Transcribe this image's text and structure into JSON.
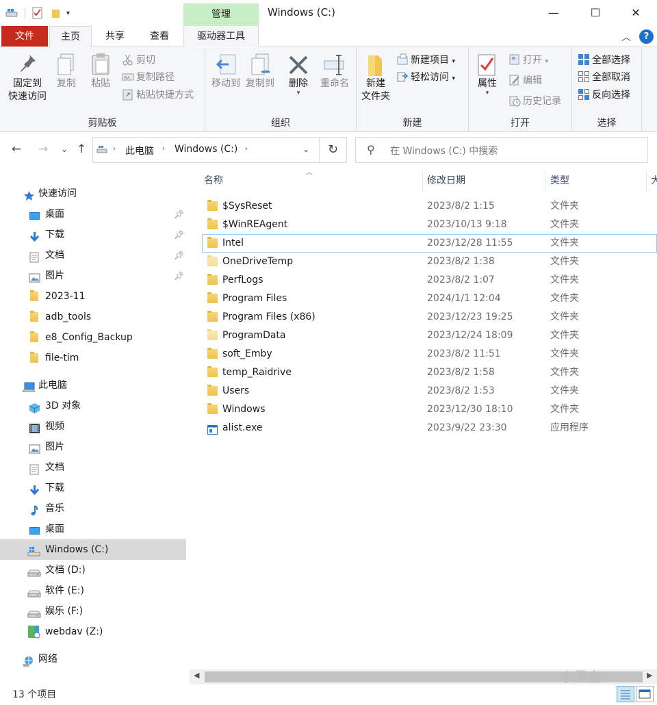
{
  "window": {
    "title": "Windows (C:)",
    "manage_tab": "管理",
    "minimize": "—",
    "maximize": "☐",
    "close": "✕"
  },
  "tabs": {
    "file": "文件",
    "home": "主页",
    "share": "共享",
    "view": "查看",
    "drive_tools": "驱动器工具",
    "help": "?"
  },
  "ribbon": {
    "clipboard": {
      "label": "剪贴板",
      "pin_quick_access": [
        "固定到",
        "快速访问"
      ],
      "copy": "复制",
      "paste": "粘贴",
      "cut": "剪切",
      "copy_path": "复制路径",
      "paste_shortcut": "粘贴快捷方式"
    },
    "organize": {
      "label": "组织",
      "move_to": "移动到",
      "copy_to": "复制到",
      "delete": "删除",
      "rename": "重命名"
    },
    "new": {
      "label": "新建",
      "new_folder": [
        "新建",
        "文件夹"
      ],
      "new_item": "新建项目",
      "easy_access": "轻松访问"
    },
    "open": {
      "label": "打开",
      "properties": "属性",
      "open": "打开",
      "edit": "编辑",
      "history": "历史记录"
    },
    "select": {
      "label": "选择",
      "select_all": "全部选择",
      "select_none": "全部取消",
      "invert": "反向选择"
    }
  },
  "address": {
    "crumbs": [
      "此电脑",
      "Windows (C:)"
    ],
    "search_placeholder": "在 Windows (C:) 中搜索"
  },
  "nav": {
    "quick_access": "快速访问",
    "quick_items": [
      {
        "label": "桌面",
        "icon": "desktop-icon",
        "pinned": true
      },
      {
        "label": "下载",
        "icon": "download-icon",
        "pinned": true
      },
      {
        "label": "文档",
        "icon": "document-icon",
        "pinned": true
      },
      {
        "label": "图片",
        "icon": "picture-icon",
        "pinned": true
      },
      {
        "label": "2023-11",
        "icon": "folder-icon",
        "pinned": false
      },
      {
        "label": "adb_tools",
        "icon": "folder-icon",
        "pinned": false
      },
      {
        "label": "e8_Config_Backup",
        "icon": "folder-icon",
        "pinned": false
      },
      {
        "label": "file-tim",
        "icon": "folder-icon",
        "pinned": false
      }
    ],
    "this_pc": "此电脑",
    "pc_items": [
      {
        "label": "3D 对象",
        "icon": "3d-objects-icon"
      },
      {
        "label": "视频",
        "icon": "video-icon"
      },
      {
        "label": "图片",
        "icon": "picture-icon"
      },
      {
        "label": "文档",
        "icon": "document-icon"
      },
      {
        "label": "下载",
        "icon": "download-icon"
      },
      {
        "label": "音乐",
        "icon": "music-icon"
      },
      {
        "label": "桌面",
        "icon": "desktop-icon"
      },
      {
        "label": "Windows (C:)",
        "icon": "windows-drive-icon",
        "selected": true
      },
      {
        "label": "文档 (D:)",
        "icon": "drive-icon"
      },
      {
        "label": "软件 (E:)",
        "icon": "drive-icon"
      },
      {
        "label": "娱乐 (F:)",
        "icon": "drive-icon"
      },
      {
        "label": "webdav (Z:)",
        "icon": "network-drive-icon"
      }
    ],
    "network": "网络"
  },
  "columns": {
    "name": "名称",
    "date": "修改日期",
    "type": "类型",
    "size": "大"
  },
  "files": [
    {
      "name": "$SysReset",
      "date": "2023/8/2 1:15",
      "type": "文件夹",
      "icon": "folder-icon"
    },
    {
      "name": "$WinREAgent",
      "date": "2023/10/13 9:18",
      "type": "文件夹",
      "icon": "folder-icon"
    },
    {
      "name": "Intel",
      "date": "2023/12/28 11:55",
      "type": "文件夹",
      "icon": "folder-icon",
      "focused": true
    },
    {
      "name": "OneDriveTemp",
      "date": "2023/8/2 1:38",
      "type": "文件夹",
      "icon": "folder-icon"
    },
    {
      "name": "PerfLogs",
      "date": "2023/8/2 1:07",
      "type": "文件夹",
      "icon": "folder-icon"
    },
    {
      "name": "Program Files",
      "date": "2024/1/1 12:04",
      "type": "文件夹",
      "icon": "folder-icon"
    },
    {
      "name": "Program Files (x86)",
      "date": "2023/12/23 19:25",
      "type": "文件夹",
      "icon": "folder-icon"
    },
    {
      "name": "ProgramData",
      "date": "2023/12/24 18:09",
      "type": "文件夹",
      "icon": "folder-icon"
    },
    {
      "name": "soft_Emby",
      "date": "2023/8/2 11:51",
      "type": "文件夹",
      "icon": "folder-icon"
    },
    {
      "name": "temp_Raidrive",
      "date": "2023/8/2 1:58",
      "type": "文件夹",
      "icon": "folder-icon"
    },
    {
      "name": "Users",
      "date": "2023/8/2 1:53",
      "type": "文件夹",
      "icon": "folder-icon"
    },
    {
      "name": "Windows",
      "date": "2023/12/30 18:10",
      "type": "文件夹",
      "icon": "folder-icon"
    },
    {
      "name": "alist.exe",
      "date": "2023/9/22 23:30",
      "type": "应用程序",
      "icon": "exe-icon"
    }
  ],
  "status": {
    "count": "13 个项目"
  },
  "watermark": "小黑盒"
}
